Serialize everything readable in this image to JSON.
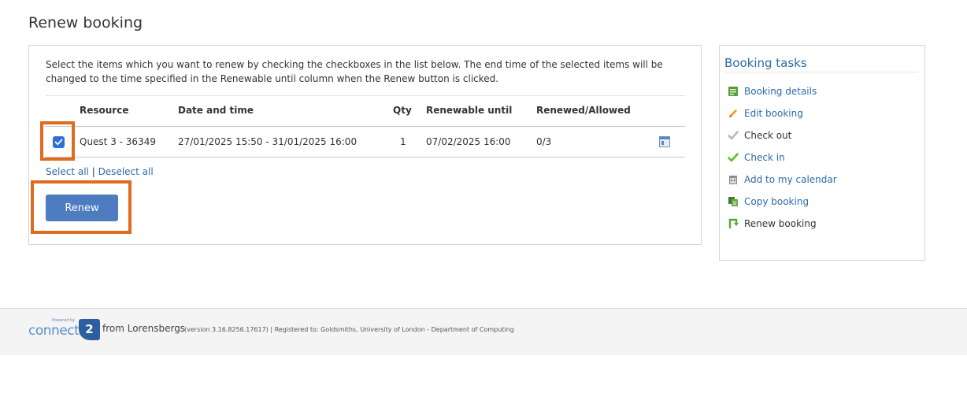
{
  "page": {
    "title": "Renew booking"
  },
  "renew": {
    "intro": "Select the items which you want to renew by checking the checkboxes in the list below. The end time of the selected items will be changed to the time specified in the Renewable until column when the Renew button is clicked.",
    "columns": {
      "resource": "Resource",
      "datetime": "Date and time",
      "qty": "Qty",
      "renewable_until": "Renewable until",
      "renewed_allowed": "Renewed/Allowed"
    },
    "rows": [
      {
        "checked": true,
        "resource": "Quest 3 - 36349",
        "datetime": "27/01/2025 15:50 - 31/01/2025 16:00",
        "qty": "1",
        "renewable_until": "07/02/2025 16:00",
        "renewed_allowed": "0/3"
      }
    ],
    "select_all": "Select all",
    "separator": "|",
    "deselect_all": "Deselect all",
    "button_label": "Renew"
  },
  "tasks": {
    "title": "Booking tasks",
    "items": [
      {
        "label": "Booking details",
        "icon": "booking-details-icon"
      },
      {
        "label": "Edit booking",
        "icon": "pencil-icon"
      },
      {
        "label": "Check out",
        "icon": "grey-checkmark-icon"
      },
      {
        "label": "Check in",
        "icon": "green-checkmark-icon"
      },
      {
        "label": "Add to my calendar",
        "icon": "calendar-add-icon"
      },
      {
        "label": "Copy booking",
        "icon": "copy-icon"
      },
      {
        "label": "Renew booking",
        "icon": "renew-icon"
      }
    ]
  },
  "footer": {
    "logo_small": "Powered by",
    "logo_word": "connect",
    "logo_badge": "2",
    "from": "from Lorensbergs",
    "version": "(version 3.16.8256.17617) | Registered to: Goldsmiths, University of London - Department of Computing"
  },
  "colors": {
    "link": "#2c6aab",
    "button": "#4d7cc0",
    "highlight": "#df6b1f",
    "checkbox": "#2f6fd6"
  }
}
